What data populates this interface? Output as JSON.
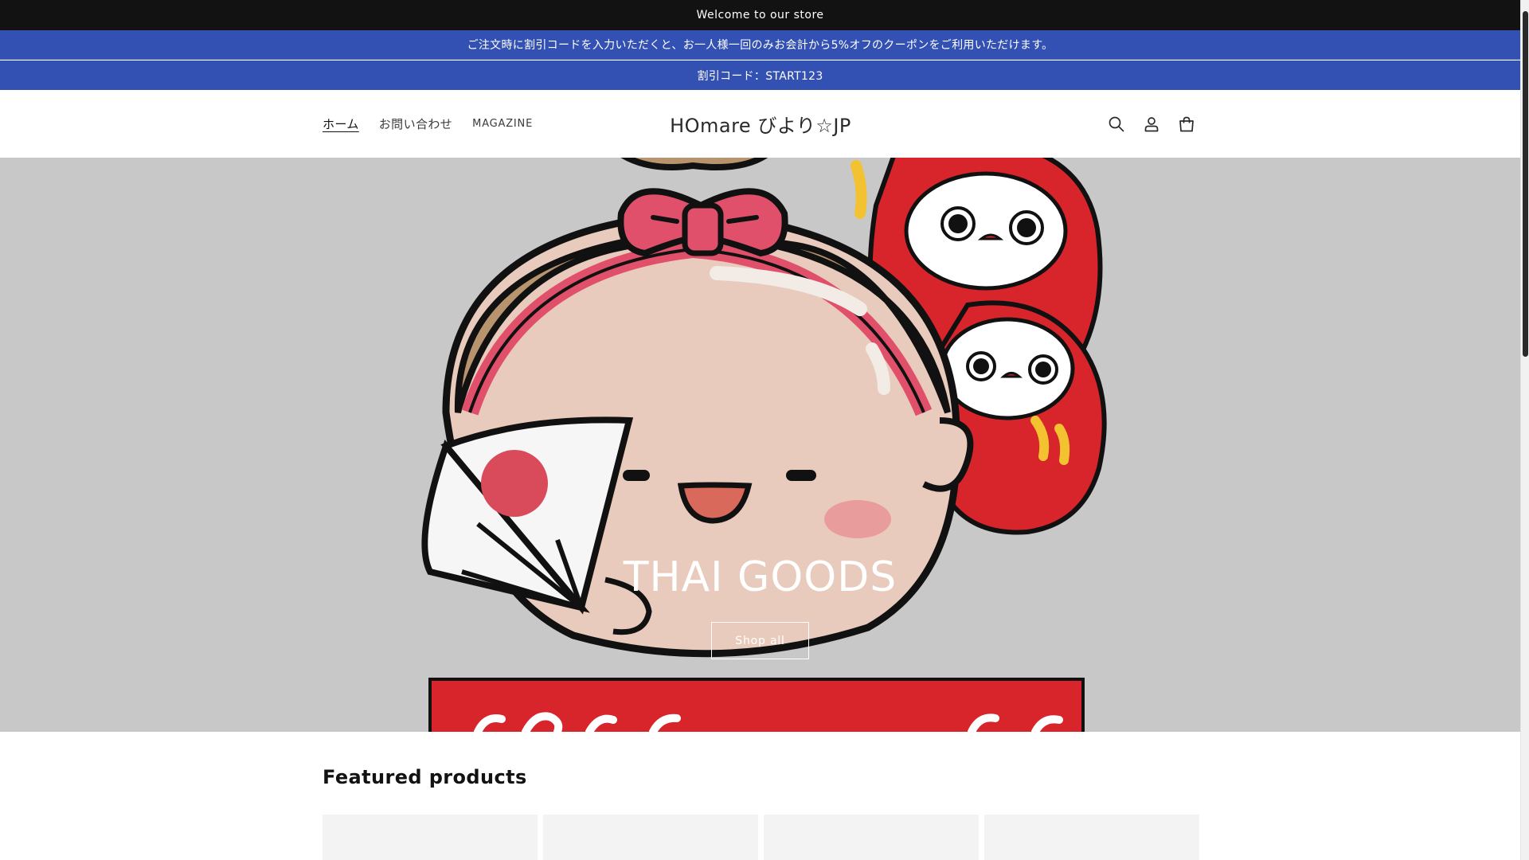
{
  "announcements": {
    "welcome": "Welcome to our store",
    "coupon_notice": "ご注文時に割引コードを入力いただくと、お一人様一回のみお会計から5%オフのクーポンをご利用いただけます。",
    "discount_code": "割引コード：START123"
  },
  "header": {
    "nav": [
      {
        "label": "ホーム",
        "active": true
      },
      {
        "label": "お問い合わせ",
        "active": false
      },
      {
        "label": "MAGAZINE",
        "active": false
      }
    ],
    "logo": "HOmare びより☆JP",
    "icons": [
      "search-icon",
      "account-icon",
      "cart-icon"
    ]
  },
  "hero": {
    "title": "THAI GOODS",
    "button_label": "Shop all"
  },
  "featured": {
    "title": "Featured products",
    "product_count_visible": 4
  },
  "colors": {
    "announcement_dark": "#121212",
    "announcement_blue": "#3350b3",
    "hero_background": "#c8c8c8",
    "daruma_red": "#d8252b",
    "bow_pink": "#e0506a"
  }
}
